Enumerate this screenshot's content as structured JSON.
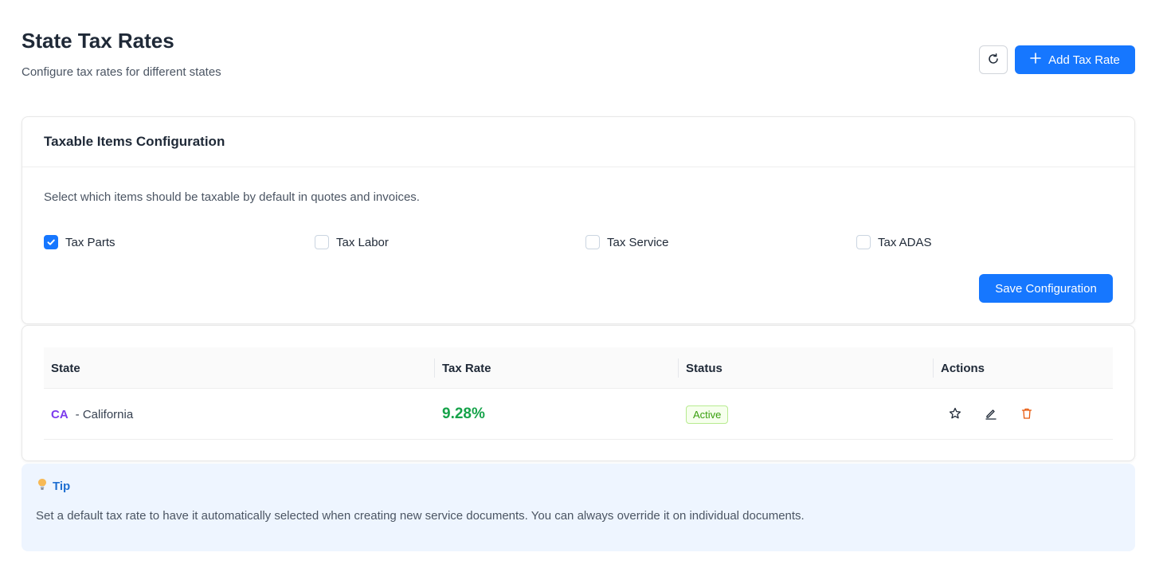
{
  "header": {
    "title": "State Tax Rates",
    "subtitle": "Configure tax rates for different states",
    "add_label": "Add Tax Rate",
    "refresh_icon": "refresh-icon",
    "add_icon": "plus-icon"
  },
  "config": {
    "title": "Taxable Items Configuration",
    "description": "Select which items should be taxable by default in quotes and invoices.",
    "options": [
      {
        "label": "Tax Parts",
        "checked": true
      },
      {
        "label": "Tax Labor",
        "checked": false
      },
      {
        "label": "Tax Service",
        "checked": false
      },
      {
        "label": "Tax ADAS",
        "checked": false
      }
    ],
    "save_label": "Save Configuration"
  },
  "table": {
    "columns": [
      "State",
      "Tax Rate",
      "Status",
      "Actions"
    ],
    "rows": [
      {
        "code": "CA",
        "name": "- California",
        "rate": "9.28%",
        "status": "Active"
      }
    ],
    "action_icons": [
      "star-icon",
      "edit-icon",
      "delete-icon"
    ]
  },
  "tip": {
    "title": "Tip",
    "text": "Set a default tax rate to have it automatically selected when creating new service documents. You can always override it on individual documents.",
    "icon": "lightbulb-icon"
  },
  "colors": {
    "primary": "#1677ff",
    "state_code": "#7c3aed",
    "rate": "#16a34a",
    "status_active": "#389e0d",
    "delete": "#e8590c",
    "tip_bg": "#eef5ff",
    "tip_title": "#1f6fd1"
  }
}
